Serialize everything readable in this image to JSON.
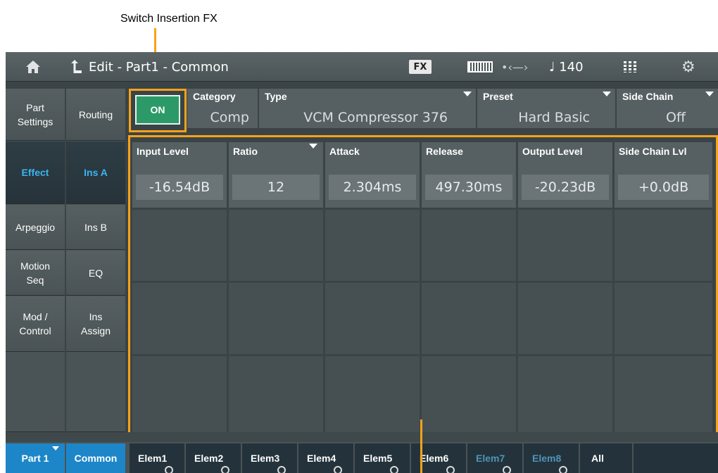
{
  "callout": {
    "top_label": "Switch Insertion FX"
  },
  "topbar": {
    "home_icon": "home-icon",
    "back_icon": "back-arrow-icon",
    "title": "Edit - Part1 - Common",
    "fx_badge": "FX",
    "keyboard_icon": "keyboard-icon",
    "usb_icon": "usb-icon",
    "tempo": "♩ 140",
    "grid_icon": "grid-icon",
    "settings_icon": "gear-icon"
  },
  "left_nav": {
    "col1": [
      {
        "label": "Part\nSettings",
        "active": false
      },
      {
        "label": "Effect",
        "active": true
      },
      {
        "label": "Arpeggio",
        "active": false
      },
      {
        "label": "Motion\nSeq",
        "active": false
      },
      {
        "label": "Mod /\nControl",
        "active": false
      }
    ],
    "col2": [
      {
        "label": "Routing",
        "active": false
      },
      {
        "label": "Ins A",
        "active": true
      },
      {
        "label": "Ins B",
        "active": false
      },
      {
        "label": "EQ",
        "active": false
      },
      {
        "label": "Ins\nAssign",
        "active": false
      }
    ]
  },
  "header": {
    "switch": "ON",
    "category": {
      "label": "Category",
      "value": "Comp"
    },
    "type": {
      "label": "Type",
      "value": "VCM Compressor 376"
    },
    "preset": {
      "label": "Preset",
      "value": "Hard Basic"
    },
    "side_chain": {
      "label": "Side Chain",
      "value": "Off"
    }
  },
  "params": [
    {
      "label": "Input Level",
      "value": "-16.54dB"
    },
    {
      "label": "Ratio",
      "value": "12"
    },
    {
      "label": "Attack",
      "value": "2.304ms"
    },
    {
      "label": "Release",
      "value": "497.30ms"
    },
    {
      "label": "Output Level",
      "value": "-20.23dB"
    },
    {
      "label": "Side Chain Lvl",
      "value": "+0.0dB"
    }
  ],
  "bottom_tabs": {
    "part": "Part 1",
    "common": "Common",
    "elements": [
      "Elem1",
      "Elem2",
      "Elem3",
      "Elem4",
      "Elem5",
      "Elem6",
      "Elem7",
      "Elem8"
    ],
    "all": "All"
  },
  "colors": {
    "accent_orange": "#f7a21b",
    "on_green": "#2c9a68",
    "active_blue": "#39b6f0",
    "tab_blue": "#1d86c8"
  }
}
